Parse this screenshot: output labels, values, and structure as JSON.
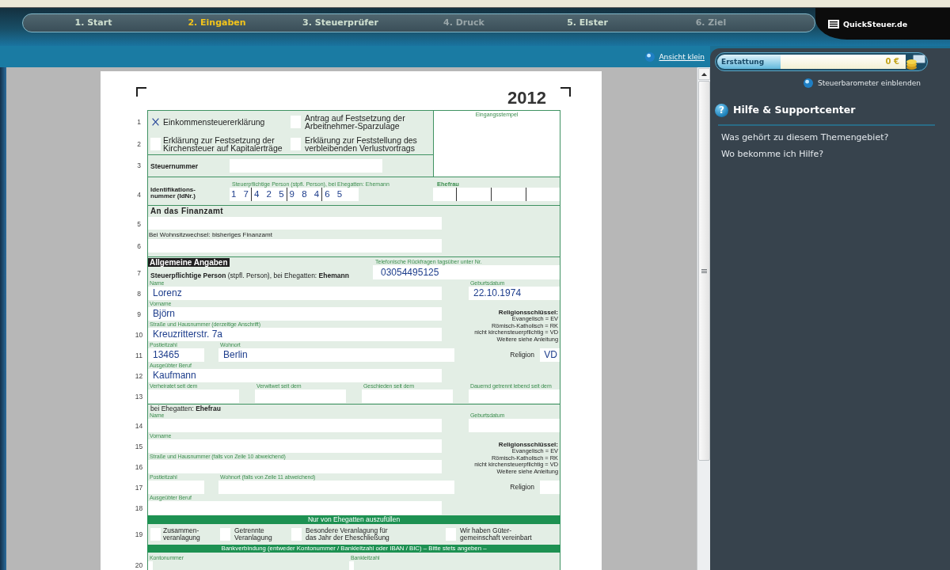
{
  "steps": [
    {
      "label": "1. Start",
      "selected": false,
      "disabled": false
    },
    {
      "label": "2. Eingaben",
      "selected": true,
      "disabled": false
    },
    {
      "label": "3. Steuerprüfer",
      "selected": false,
      "disabled": false
    },
    {
      "label": "4. Druck",
      "selected": false,
      "disabled": true
    },
    {
      "label": "5. Elster",
      "selected": false,
      "disabled": false
    },
    {
      "label": "6. Ziel",
      "selected": false,
      "disabled": true
    }
  ],
  "logo": {
    "text": "QuickSteuer.de"
  },
  "view_link": "Ansicht klein",
  "refund": {
    "label": "Erstattung",
    "value": "0 €"
  },
  "barometer_link": "Steuerbarometer einblenden",
  "help": {
    "icon": "?",
    "title": "Hilfe & Supportcenter",
    "links": [
      "Was gehört zu diesem Themengebiet?",
      "Wo bekomme ich Hilfe?"
    ]
  },
  "form": {
    "year": "2012",
    "declarations": [
      {
        "line": "1",
        "options": [
          {
            "label": "Einkommensteuererklärung",
            "checked": true
          },
          {
            "label": "Antrag auf Festsetzung der\nArbeitnehmer-Sparzulage",
            "checked": false
          }
        ]
      },
      {
        "line": "2",
        "options": [
          {
            "label": "Erklärung zur Festsetzung der\nKirchensteuer auf Kapitalerträge",
            "checked": false
          },
          {
            "label": "Erklärung zur Feststellung des\nverbleibenden Verlustvortrags",
            "checked": false
          }
        ]
      }
    ],
    "stamp_label": "Eingangsstempel",
    "tax_number": {
      "line": "3",
      "label": "Steuernummer"
    },
    "id_number": {
      "line": "4",
      "label": "Identifikations-\nnummer (IdNr.)",
      "person_label": "Steuerpflichtige Person (stpfl. Person), bei Ehegatten: Ehemann",
      "digit_groups": [
        "1 7",
        "4 2 5",
        "9 8 4",
        "6 5"
      ],
      "spouse_label": "Ehefrau"
    },
    "tax_office": {
      "title": "An das Finanzamt",
      "line": "5",
      "move_label": "Bei Wohnsitzwechsel: bisheriges Finanzamt",
      "move_line": "6"
    },
    "taxpayer": {
      "badge": "Allgemeine Angaben",
      "line": "7",
      "heading": "**Steuerpflichtige Person** (stpfl. Person), bei Ehegatten: **Ehemann**",
      "phone_label": "Telefonische Rückfragen tagsüber unter Nr.",
      "phone": "03054495125",
      "rows": [
        {
          "kind": "name",
          "line": "8",
          "fields": [
            {
              "label": "Name",
              "value": "Lorenz"
            },
            {
              "label": "Geburtsdatum",
              "value": "22.10.1974"
            }
          ]
        },
        {
          "kind": "address",
          "lines": [
            "9",
            "10"
          ],
          "fields": [
            {
              "label": "Vorname",
              "value": "Björn"
            },
            {
              "label": "Straße und Hausnummer (derzeitige Anschrift)",
              "value": "Kreuzritterstr. 7a"
            }
          ],
          "key": {
            "title": "Religionsschlüssel:",
            "entries": [
              "Evangelisch = EV",
              "Römisch-Katholisch = RK",
              "nicht kirchensteuerpflichtig = VD",
              "Weitere siehe Anleitung"
            ]
          }
        },
        {
          "kind": "place",
          "line": "11",
          "fields": [
            {
              "label": "Postleitzahl",
              "value": "13465"
            },
            {
              "label": "Wohnort",
              "value": "Berlin"
            },
            {
              "label": "Religion",
              "value": "VD"
            }
          ]
        },
        {
          "kind": "wide",
          "line": "12",
          "fields": [
            {
              "label": "Ausgeübter Beruf",
              "value": "Kaufmann"
            }
          ]
        },
        {
          "kind": "dates",
          "line": "13",
          "fields": [
            {
              "label": "Verheiratet seit dem"
            },
            {
              "label": "Verwitwet seit dem"
            },
            {
              "label": "Geschieden seit dem"
            },
            {
              "label": "Dauernd getrennt lebend seit dem"
            }
          ]
        }
      ]
    },
    "spouse": {
      "heading": "bei Ehegatten: **Ehefrau**",
      "rows": [
        {
          "kind": "name",
          "line": "14",
          "fields": [
            {
              "label": "Name"
            },
            {
              "label": "Geburtsdatum"
            }
          ]
        },
        {
          "kind": "address",
          "lines": [
            "15",
            "16"
          ],
          "fields": [
            {
              "label": "Vorname"
            },
            {
              "label": "Straße und Hausnummer (falls von Zeile 10 abweichend)"
            }
          ],
          "key": {
            "title": "Religionsschlüssel:",
            "entries": [
              "Evangelisch = EV",
              "Römisch-Katholisch = RK",
              "nicht kirchensteuerpflichtig = VD",
              "Weitere siehe Anleitung"
            ]
          }
        },
        {
          "kind": "place",
          "line": "17",
          "fields": [
            {
              "label": "Postleitzahl"
            },
            {
              "label": "Wohnort (falls von Zeile 11 abweichend)"
            },
            {
              "label": "Religion"
            }
          ]
        },
        {
          "kind": "wide",
          "line": "18",
          "fields": [
            {
              "label": "Ausgeübter Beruf"
            }
          ]
        }
      ]
    },
    "spouse_banner": "Nur von Ehegatten auszufüllen",
    "assessment": {
      "line": "19",
      "options": [
        {
          "label": "Zusammen-\nveranlagung",
          "checked": false
        },
        {
          "label": "Getrennte\nVeranlagung",
          "checked": false
        },
        {
          "label": "Besondere Veranlagung für\ndas Jahr der Eheschließung",
          "checked": false
        },
        {
          "label": "Wir haben Güter-\ngemeinschaft vereinbart",
          "checked": false
        }
      ]
    },
    "bank_banner": "Bankverbindung (entweder Kontonummer / Bankleitzahl oder IBAN / BIC) – Bitte stets angeben –",
    "bank": {
      "line": "20",
      "fields": [
        {
          "label": "Kontonummer"
        },
        {
          "label": "Bankleitzahl"
        }
      ]
    }
  }
}
